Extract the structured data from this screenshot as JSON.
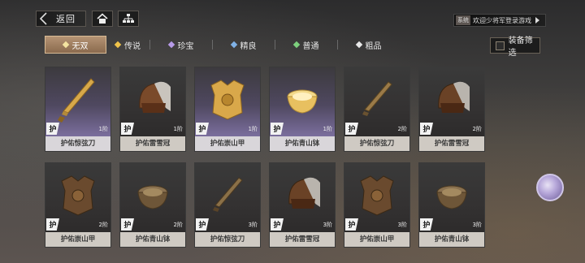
{
  "header": {
    "back_label": "返回",
    "notice_tag": "系统",
    "notice_text": "欢迎少将军登录游戏"
  },
  "tabs": [
    {
      "label": "无双",
      "color": "#f3e3a0",
      "active": true
    },
    {
      "label": "传说",
      "color": "#f0c34a"
    },
    {
      "label": "珍宝",
      "color": "#b79be8"
    },
    {
      "label": "精良",
      "color": "#7fb1e6"
    },
    {
      "label": "普通",
      "color": "#7dd07d"
    },
    {
      "label": "粗品",
      "color": "#e8e8e8"
    }
  ],
  "filter_label": "装备筛选",
  "badge_text": "护",
  "items": [
    {
      "name": "护佑惊弦刀",
      "tier": "1阶",
      "icon": "sword-icon",
      "rare": true
    },
    {
      "name": "护佑雷雪冠",
      "tier": "1阶",
      "icon": "helmet-icon"
    },
    {
      "name": "护佑崇山甲",
      "tier": "1阶",
      "icon": "armor-icon",
      "rare": true
    },
    {
      "name": "护佑青山钵",
      "tier": "1阶",
      "icon": "bowl-icon",
      "rare": true
    },
    {
      "name": "护佑惊弦刀",
      "tier": "2阶",
      "icon": "sword-icon"
    },
    {
      "name": "护佑雷雪冠",
      "tier": "2阶",
      "icon": "helmet-icon"
    },
    {
      "name": "护佑崇山甲",
      "tier": "2阶",
      "icon": "armor-icon"
    },
    {
      "name": "护佑青山钵",
      "tier": "2阶",
      "icon": "bowl-icon"
    },
    {
      "name": "护佑惊弦刀",
      "tier": "3阶",
      "icon": "sword-icon"
    },
    {
      "name": "护佑雷雪冠",
      "tier": "3阶",
      "icon": "helmet-icon"
    },
    {
      "name": "护佑崇山甲",
      "tier": "3阶",
      "icon": "armor-icon"
    },
    {
      "name": "护佑青山钵",
      "tier": "3阶",
      "icon": "bowl-icon"
    }
  ]
}
